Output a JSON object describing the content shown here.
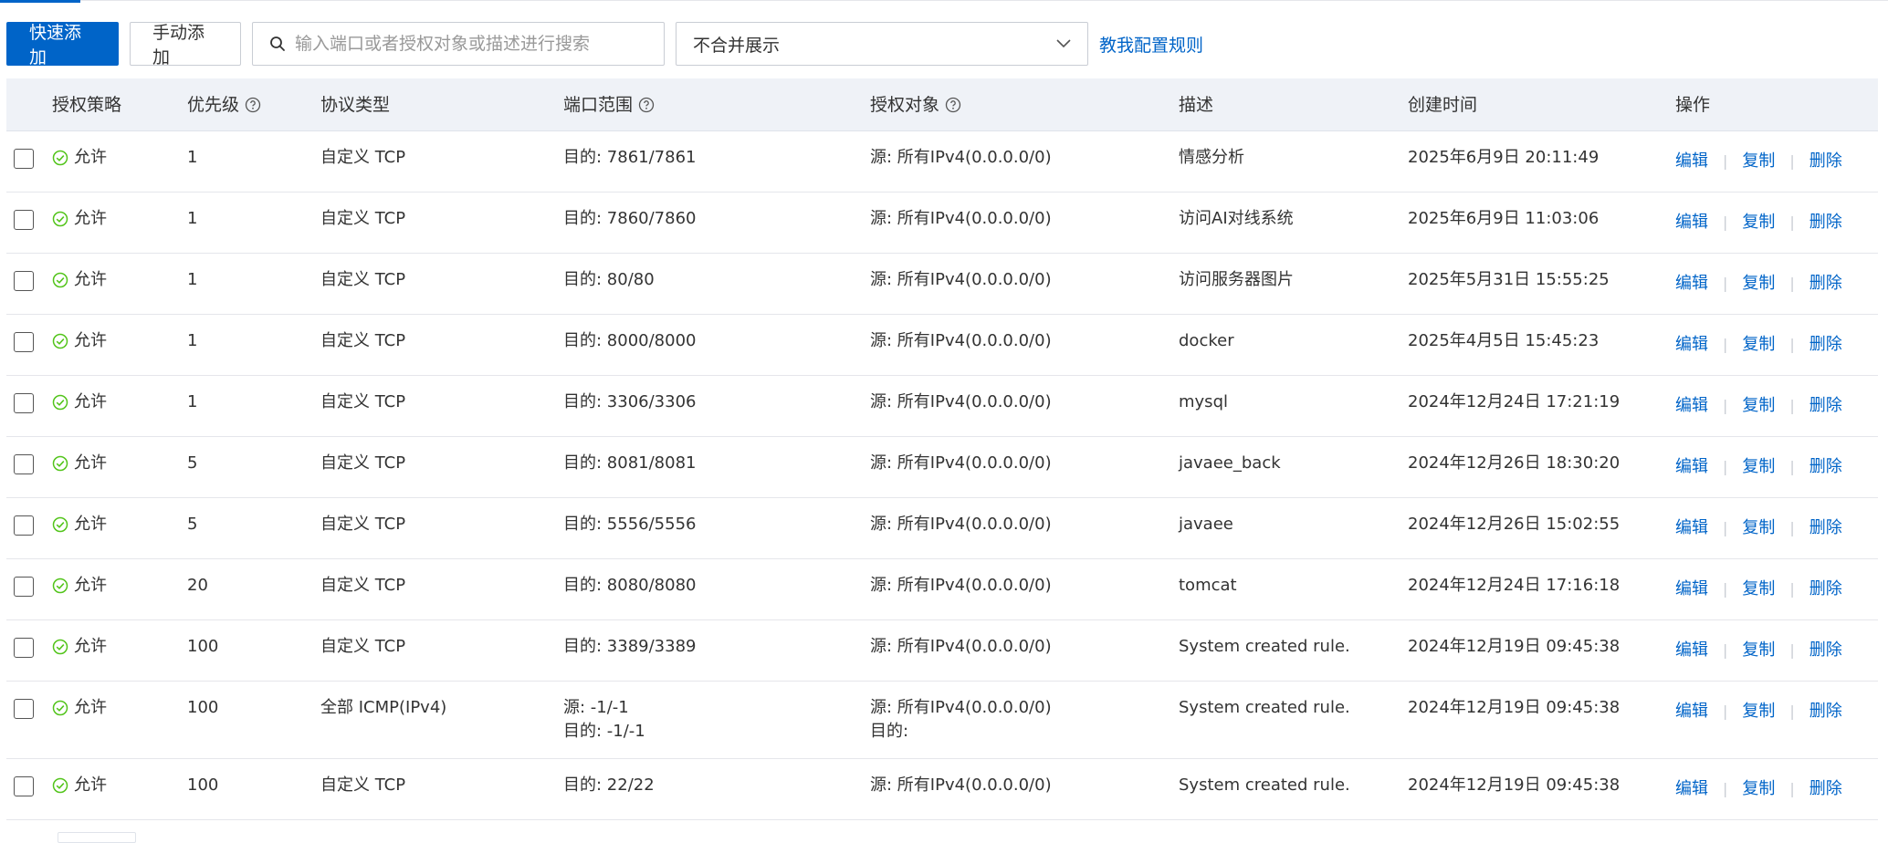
{
  "toolbar": {
    "quick_add": "快速添加",
    "manual_add": "手动添加",
    "search_placeholder": "输入端口或者授权对象或描述进行搜索",
    "merge_select": "不合并展示",
    "help_link": "教我配置规则"
  },
  "table": {
    "headers": {
      "policy": "授权策略",
      "priority": "优先级",
      "protocol": "协议类型",
      "port": "端口范围",
      "auth": "授权对象",
      "desc": "描述",
      "time": "创建时间",
      "ops": "操作"
    },
    "ops": {
      "edit": "编辑",
      "copy": "复制",
      "delete": "删除"
    },
    "rows": [
      {
        "policy": "允许",
        "priority": "1",
        "protocol": "自定义 TCP",
        "port": "目的: 7861/7861",
        "auth": "源: 所有IPv4(0.0.0.0/0)",
        "desc": "情感分析",
        "time": "2025年6月9日 20:11:49"
      },
      {
        "policy": "允许",
        "priority": "1",
        "protocol": "自定义 TCP",
        "port": "目的: 7860/7860",
        "auth": "源: 所有IPv4(0.0.0.0/0)",
        "desc": "访问AI对线系统",
        "time": "2025年6月9日 11:03:06"
      },
      {
        "policy": "允许",
        "priority": "1",
        "protocol": "自定义 TCP",
        "port": "目的: 80/80",
        "auth": "源: 所有IPv4(0.0.0.0/0)",
        "desc": "访问服务器图片",
        "time": "2025年5月31日 15:55:25"
      },
      {
        "policy": "允许",
        "priority": "1",
        "protocol": "自定义 TCP",
        "port": "目的: 8000/8000",
        "auth": "源: 所有IPv4(0.0.0.0/0)",
        "desc": "docker",
        "time": "2025年4月5日 15:45:23"
      },
      {
        "policy": "允许",
        "priority": "1",
        "protocol": "自定义 TCP",
        "port": "目的: 3306/3306",
        "auth": "源: 所有IPv4(0.0.0.0/0)",
        "desc": "mysql",
        "time": "2024年12月24日 17:21:19"
      },
      {
        "policy": "允许",
        "priority": "5",
        "protocol": "自定义 TCP",
        "port": "目的: 8081/8081",
        "auth": "源: 所有IPv4(0.0.0.0/0)",
        "desc": "javaee_back",
        "time": "2024年12月26日 18:30:20"
      },
      {
        "policy": "允许",
        "priority": "5",
        "protocol": "自定义 TCP",
        "port": "目的: 5556/5556",
        "auth": "源: 所有IPv4(0.0.0.0/0)",
        "desc": "javaee",
        "time": "2024年12月26日 15:02:55"
      },
      {
        "policy": "允许",
        "priority": "20",
        "protocol": "自定义 TCP",
        "port": "目的: 8080/8080",
        "auth": "源: 所有IPv4(0.0.0.0/0)",
        "desc": "tomcat",
        "time": "2024年12月24日 17:16:18"
      },
      {
        "policy": "允许",
        "priority": "100",
        "protocol": "自定义 TCP",
        "port": "目的: 3389/3389",
        "auth": "源: 所有IPv4(0.0.0.0/0)",
        "desc": "System created rule.",
        "time": "2024年12月19日 09:45:38"
      },
      {
        "policy": "允许",
        "priority": "100",
        "protocol": "全部 ICMP(IPv4)",
        "port": "源: -1/-1",
        "port2": "目的: -1/-1",
        "auth": "源: 所有IPv4(0.0.0.0/0)",
        "auth2": "目的:",
        "desc": "System created rule.",
        "time": "2024年12月19日 09:45:38"
      },
      {
        "policy": "允许",
        "priority": "100",
        "protocol": "自定义 TCP",
        "port": "目的: 22/22",
        "auth": "源: 所有IPv4(0.0.0.0/0)",
        "desc": "System created rule.",
        "time": "2024年12月19日 09:45:38"
      }
    ]
  },
  "colors": {
    "primary": "#0064c8",
    "allow_green": "#52c41a",
    "header_bg": "#eff2f7"
  }
}
